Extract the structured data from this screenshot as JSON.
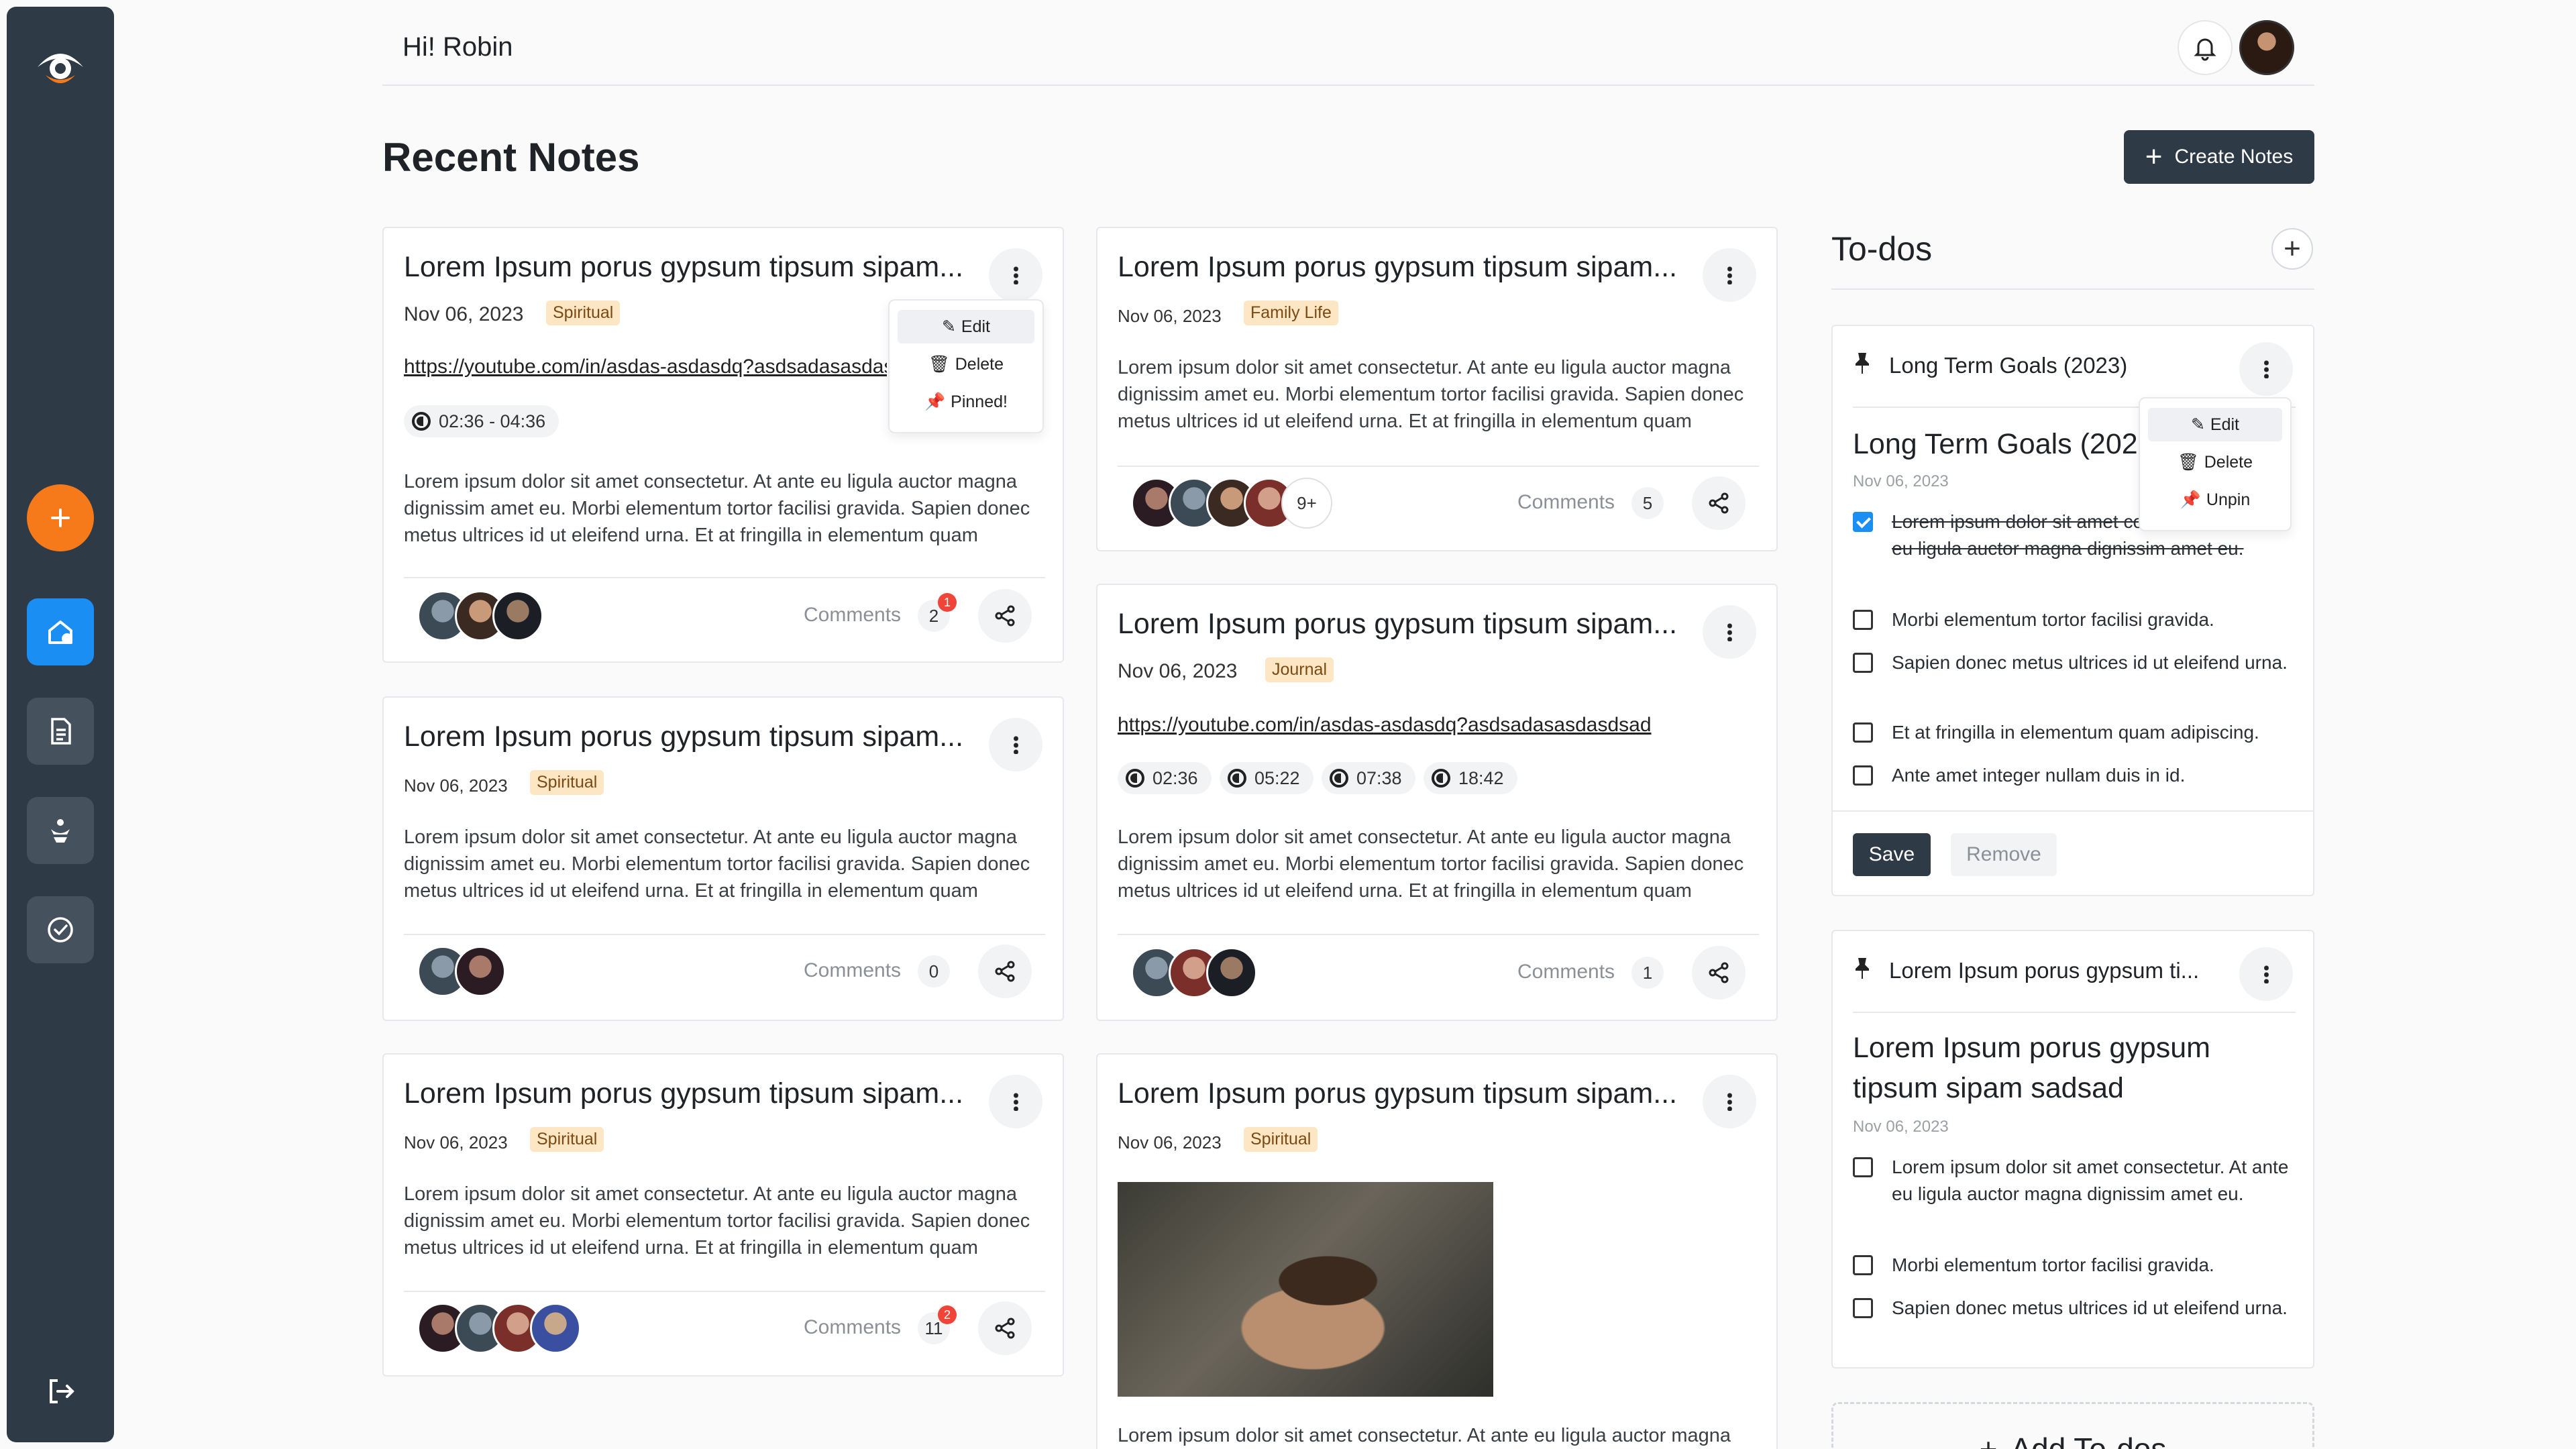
{
  "header": {
    "greeting": "Hi! Robin"
  },
  "page": {
    "title": "Recent Notes",
    "create_label": "Create Notes"
  },
  "sidebar": {
    "items": [
      {
        "icon": "add-icon"
      },
      {
        "icon": "home-icon",
        "active": true
      },
      {
        "icon": "notes-icon"
      },
      {
        "icon": "meditation-icon"
      },
      {
        "icon": "check-circle-icon"
      },
      {
        "icon": "logout-icon"
      }
    ]
  },
  "colors": {
    "sidebar": "#2f3a47",
    "accent_orange": "#f6791a",
    "accent_blue": "#1a8ef2",
    "tag_bg": "#fde6c4"
  },
  "notes": [
    {
      "title": "Lorem Ipsum porus gypsum tipsum sipam...",
      "date": "Nov 06, 2023",
      "tag": "Spiritual",
      "link": "https://youtube.com/in/asdas-asdasdq?asdsadasasdasdsad",
      "times": [
        "02:36 - 04:36"
      ],
      "body": "Lorem ipsum dolor sit amet consectetur. At ante eu ligula auctor magna dignissim amet eu. Morbi elementum tortor facilisi gravida. Sapien donec metus ultrices id ut eleifend urna. Et at fringilla in elementum quam adipiscing.",
      "comments_label": "Comments",
      "comments": "2",
      "badge": "1",
      "menu": [
        "Edit",
        "Delete",
        "Pinned!"
      ]
    },
    {
      "title": "Lorem Ipsum porus gypsum tipsum sipam...",
      "date": "Nov 06, 2023",
      "tag": "Family Life",
      "body": "Lorem ipsum dolor sit amet consectetur. At ante eu ligula auctor magna dignissim amet eu. Morbi elementum tortor facilisi gravida. Sapien donec metus ultrices id ut eleifend urna. Et at fringilla in elementum quam adipiscing.",
      "comments_label": "Comments",
      "comments": "5",
      "more": "9+"
    },
    {
      "title": "Lorem Ipsum porus gypsum tipsum sipam...",
      "date": "Nov 06, 2023",
      "tag": "Spiritual",
      "body": "Lorem ipsum dolor sit amet consectetur. At ante eu ligula auctor magna dignissim amet eu. Morbi elementum tortor facilisi gravida. Sapien donec metus ultrices id ut eleifend urna. Et at fringilla in elementum quam adipiscing.",
      "comments_label": "Comments",
      "comments": "0"
    },
    {
      "title": "Lorem Ipsum porus gypsum tipsum sipam...",
      "date": "Nov 06, 2023",
      "tag": "Journal",
      "link": "https://youtube.com/in/asdas-asdasdq?asdsadasasdasdsad",
      "times": [
        "02:36",
        "05:22",
        "07:38",
        "18:42"
      ],
      "body": "Lorem ipsum dolor sit amet consectetur. At ante eu ligula auctor magna dignissim amet eu. Morbi elementum tortor facilisi gravida. Sapien donec metus ultrices id ut eleifend urna. Et at fringilla in elementum quam adipiscing.",
      "comments_label": "Comments",
      "comments": "1"
    },
    {
      "title": "Lorem Ipsum porus gypsum tipsum sipam...",
      "date": "Nov 06, 2023",
      "tag": "Spiritual",
      "body": "Lorem ipsum dolor sit amet consectetur. At ante eu ligula auctor magna dignissim amet eu. Morbi elementum tortor facilisi gravida. Sapien donec metus ultrices id ut eleifend urna. Et at fringilla in elementum quam adipiscing.",
      "comments_label": "Comments",
      "comments": "11",
      "badge": "2"
    },
    {
      "title": "Lorem Ipsum porus gypsum tipsum sipam...",
      "date": "Nov 06, 2023",
      "tag": "Spiritual",
      "body": "Lorem ipsum dolor sit amet consectetur. At ante eu ligula auctor magna"
    }
  ],
  "todos": {
    "title": "To-dos",
    "add_label": "Add To-dos",
    "lists": [
      {
        "header": "Long Term Goals (2023)",
        "title": "Long Term Goals (2023)",
        "date": "Nov 06, 2023",
        "menu": [
          "Edit",
          "Delete",
          "Unpin"
        ],
        "items": [
          {
            "text": "Lorem ipsum dolor sit amet consectetur. At ante eu ligula auctor magna dignissim amet eu.",
            "done": true
          },
          {
            "text": "Morbi elementum tortor facilisi gravida.",
            "done": false
          },
          {
            "text": "Sapien donec metus ultrices id ut eleifend urna.",
            "done": false
          },
          {
            "text": "Et at fringilla in elementum quam adipiscing.",
            "done": false
          },
          {
            "text": "Ante amet integer nullam duis in id.",
            "done": false
          }
        ],
        "save_label": "Save",
        "remove_label": "Remove"
      },
      {
        "header": "Lorem Ipsum porus gypsum ti...",
        "title": "Lorem Ipsum porus gypsum tipsum sipam sadsad",
        "date": "Nov 06, 2023",
        "items": [
          {
            "text": "Lorem ipsum dolor sit amet consectetur. At ante eu ligula auctor magna dignissim amet eu.",
            "done": false
          },
          {
            "text": "Morbi elementum tortor facilisi gravida.",
            "done": false
          },
          {
            "text": "Sapien donec metus ultrices id ut eleifend urna.",
            "done": false
          }
        ]
      }
    ]
  }
}
